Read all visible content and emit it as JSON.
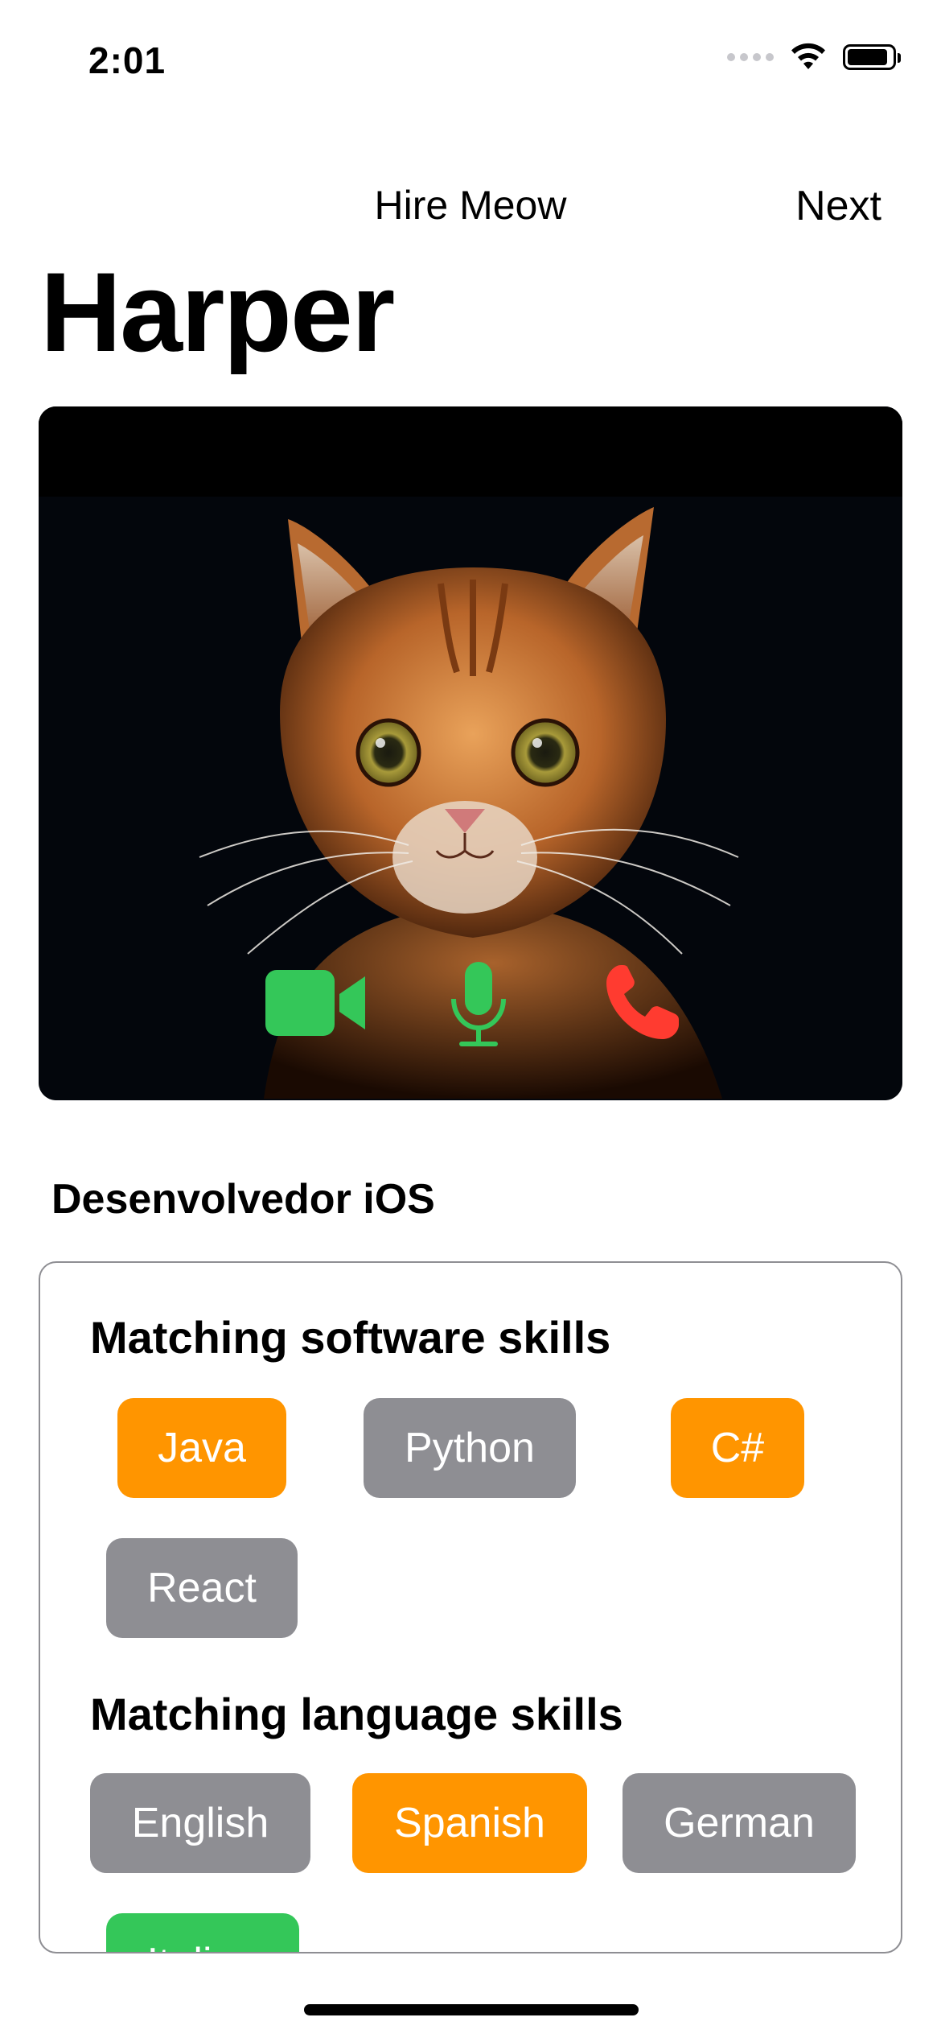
{
  "status_bar": {
    "time": "2:01",
    "battery_level": 0.9
  },
  "nav": {
    "title": "Hire Meow",
    "next_label": "Next"
  },
  "profile": {
    "name": "Harper",
    "job_title": "Desenvolvedor iOS"
  },
  "call_controls": {
    "video_icon": "video-camera-icon",
    "mic_icon": "microphone-icon",
    "end_icon": "phone-icon",
    "colors": {
      "green": "#34C759",
      "red": "#FF3B30"
    }
  },
  "software_skills": {
    "heading": "Matching software skills",
    "items": [
      {
        "label": "Java",
        "matched": true
      },
      {
        "label": "Python",
        "matched": false
      },
      {
        "label": "C#",
        "matched": true
      },
      {
        "label": "React",
        "matched": false
      }
    ]
  },
  "language_skills": {
    "heading": "Matching language skills",
    "items": [
      {
        "label": "English",
        "matched": false
      },
      {
        "label": "Spanish",
        "matched": true
      },
      {
        "label": "German",
        "matched": false
      },
      {
        "label": "Italian",
        "matched": false
      }
    ]
  },
  "colors": {
    "matched": "#FF9500",
    "unmatched": "#8E8E93",
    "accent_green": "#34C759"
  }
}
